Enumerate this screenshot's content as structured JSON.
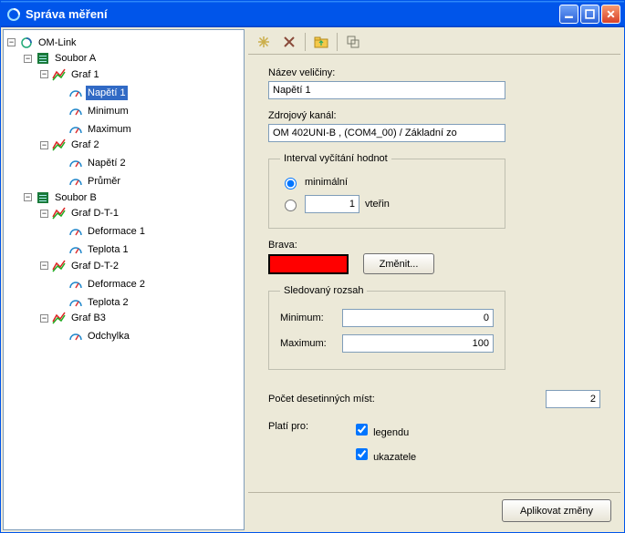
{
  "window": {
    "title": "Správa měření"
  },
  "tree": {
    "root": "OM-Link",
    "fileA": "Soubor A",
    "graf1": "Graf 1",
    "napeti1": "Napětí 1",
    "minimum_t": "Minimum",
    "maximum_t": "Maximum",
    "graf2": "Graf 2",
    "napeti2": "Napětí 2",
    "prumer": "Průměr",
    "fileB": "Soubor B",
    "grafDT1": "Graf D-T-1",
    "deformace1": "Deformace 1",
    "teplota1": "Teplota 1",
    "grafDT2": "Graf D-T-2",
    "deformace2": "Deformace 2",
    "teplota2": "Teplota 2",
    "grafB3": "Graf B3",
    "odchylka": "Odchylka"
  },
  "form": {
    "name_label": "Název veličiny:",
    "name_value": "Napětí 1",
    "channel_label": "Zdrojový kanál:",
    "channel_value": "OM 402UNI-B , (COM4_00) / Základní zo",
    "interval_legend": "Interval vyčítání hodnot",
    "interval_min": "minimální",
    "interval_num": "1",
    "interval_unit": "vteřin",
    "color_label": "Brava:",
    "color_value": "#ff0000",
    "color_btn": "Změnit...",
    "range_legend": "Sledovaný rozsah",
    "range_min_label": "Minimum:",
    "range_min_value": "0",
    "range_max_label": "Maximum:",
    "range_max_value": "100",
    "decimals_label": "Počet desetinných míst:",
    "decimals_value": "2",
    "applies_label": "Platí pro:",
    "applies_legend": "legendu",
    "applies_indicators": "ukazatele",
    "apply_btn": "Aplikovat změny"
  }
}
